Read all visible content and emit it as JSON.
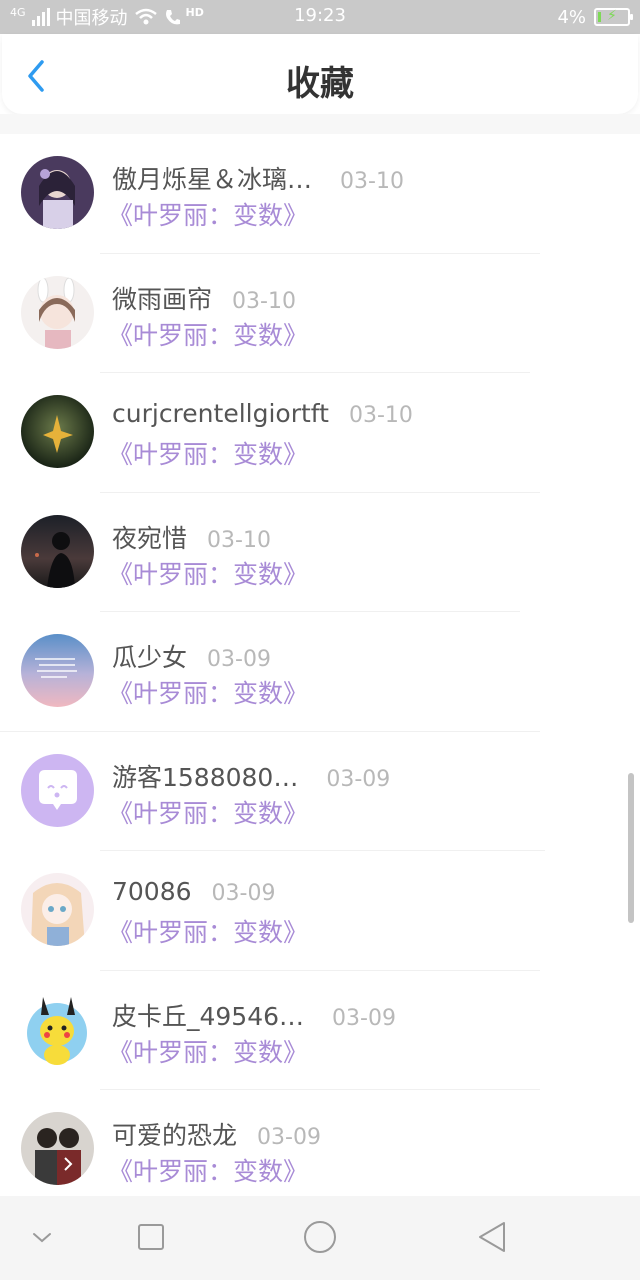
{
  "status_bar": {
    "network_type": "4G",
    "carrier": "中国移动",
    "hd": "HD",
    "time": "19:23",
    "battery_percent": "4%"
  },
  "header": {
    "title": "收藏",
    "back_icon": "chevron-left-icon"
  },
  "colors": {
    "accent_blue": "#2e9bf0",
    "link_purple": "#a88bd6",
    "name_gray": "#555555",
    "date_gray": "#b8b8b8"
  },
  "favorites": [
    {
      "name": "傲月烁星＆冰璃…",
      "date": "03-10",
      "story": "《叶罗丽：变数》"
    },
    {
      "name": "微雨画帘",
      "date": "03-10",
      "story": "《叶罗丽：变数》"
    },
    {
      "name": "curjcrentellgiortft",
      "date": "03-10",
      "story": "《叶罗丽：变数》"
    },
    {
      "name": "夜宛惜",
      "date": "03-10",
      "story": "《叶罗丽：变数》"
    },
    {
      "name": "瓜少女",
      "date": "03-09",
      "story": "《叶罗丽：变数》"
    },
    {
      "name": "游客1588080…",
      "date": "03-09",
      "story": "《叶罗丽：变数》"
    },
    {
      "name": "70086",
      "date": "03-09",
      "story": "《叶罗丽：变数》"
    },
    {
      "name": "皮卡丘_49546…",
      "date": "03-09",
      "story": "《叶罗丽：变数》"
    },
    {
      "name": "可爱的恐龙",
      "date": "03-09",
      "story": "《叶罗丽：变数》"
    }
  ],
  "nav_bar": {
    "buttons": [
      "chevron-down-icon",
      "square-icon",
      "circle-icon",
      "triangle-back-icon"
    ]
  }
}
